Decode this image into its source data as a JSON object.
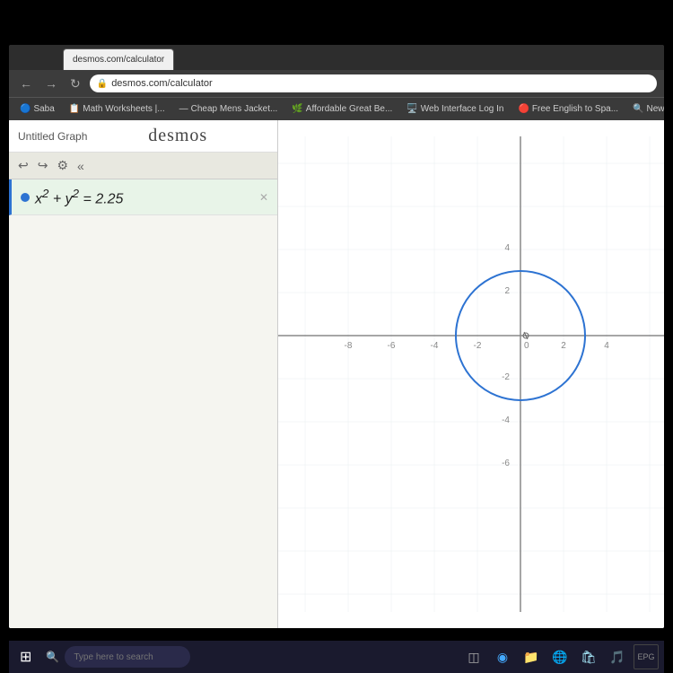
{
  "browser": {
    "url": "desmos.com/calculator",
    "tabs": [
      {
        "label": "Cheap Mens Jacket...",
        "active": false
      },
      {
        "label": "Affordable Great Be...",
        "active": false
      }
    ],
    "bookmarks": [
      {
        "label": "Saba",
        "icon": "🔵"
      },
      {
        "label": "Math Worksheets |...",
        "icon": "📋"
      },
      {
        "label": "Cheap Mens Jacket...",
        "icon": "—"
      },
      {
        "label": "Affordable Great Be...",
        "icon": "🌿"
      },
      {
        "label": "Web Interface Log In",
        "icon": "🖥️"
      },
      {
        "label": "Free English to Spa...",
        "icon": "🔴"
      },
      {
        "label": "New Tab S...",
        "icon": "🔍"
      }
    ]
  },
  "desmos": {
    "title": "Untitled Graph",
    "logo": "desmos",
    "expression": "x² + y² = 2.25",
    "expression_text": "x² + y² = 2.25",
    "graph": {
      "axis_labels": {
        "x_positive": [
          "2",
          "4"
        ],
        "x_negative": [
          "-2",
          "-4",
          "-6",
          "-8"
        ],
        "y_positive": [
          "2",
          "4"
        ],
        "y_negative": [
          "-2",
          "-4",
          "-6"
        ]
      },
      "circle": {
        "cx_graph": 0,
        "cy_graph": 0,
        "r_graph": 1.5,
        "color": "#2d73d2"
      }
    }
  },
  "taskbar": {
    "search_placeholder": "Type here to search",
    "start_icon": "⊞"
  }
}
